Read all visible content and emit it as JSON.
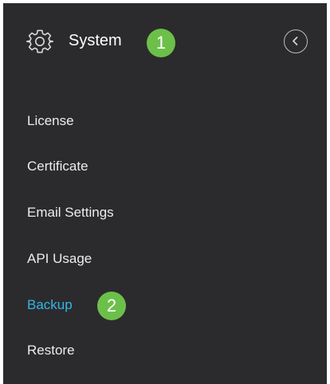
{
  "header": {
    "title": "System",
    "gear_icon": "gear-icon",
    "collapse_icon": "chevron-left-circle-icon",
    "callout": "1"
  },
  "menu": {
    "items": [
      {
        "label": "License"
      },
      {
        "label": "Certificate"
      },
      {
        "label": "Email Settings"
      },
      {
        "label": "API Usage"
      },
      {
        "label": "Backup",
        "active": true
      },
      {
        "label": "Restore"
      }
    ],
    "callout": "2"
  },
  "colors": {
    "panel_bg": "#2b2b2d",
    "text": "#ececec",
    "active_text": "#33b6e6",
    "callout_bg": "#6cc04a"
  }
}
